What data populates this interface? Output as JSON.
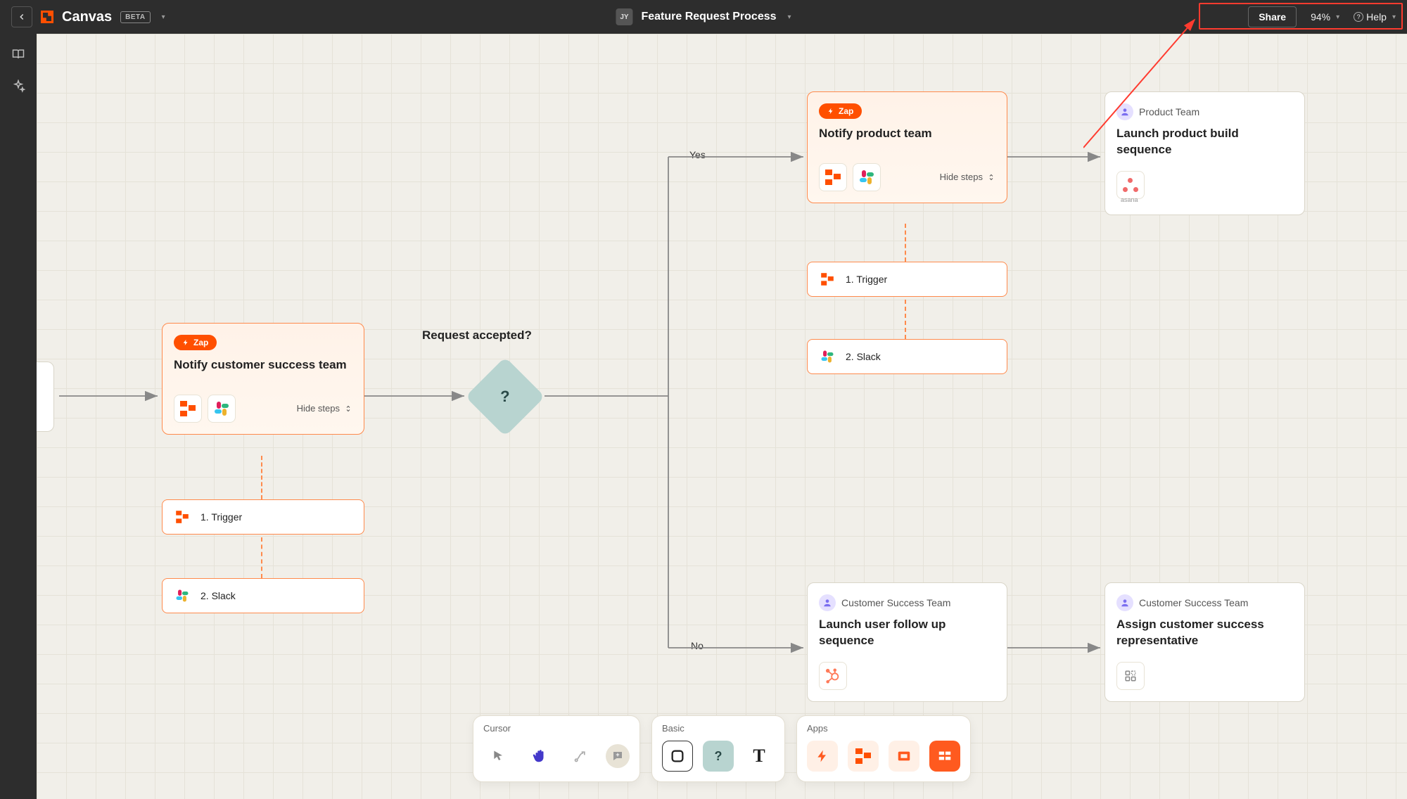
{
  "header": {
    "app_name": "Canvas",
    "beta_label": "BETA",
    "user_initials": "JY",
    "doc_title": "Feature Request Process",
    "share_label": "Share",
    "zoom_label": "94%",
    "help_label": "Help"
  },
  "decision": {
    "title": "Request accepted?",
    "symbol": "?",
    "yes_label": "Yes",
    "no_label": "No"
  },
  "zap1": {
    "badge": "Zap",
    "title": "Notify customer success team",
    "hide_label": "Hide steps",
    "step1": "1. Trigger",
    "step2": "2. Slack"
  },
  "zap2": {
    "badge": "Zap",
    "title": "Notify product team",
    "hide_label": "Hide steps",
    "step1": "1. Trigger",
    "step2": "2. Slack"
  },
  "card_product": {
    "team": "Product Team",
    "title": "Launch product build sequence"
  },
  "card_followup": {
    "team": "Customer Success Team",
    "title": "Launch user follow up sequence"
  },
  "card_assign": {
    "team": "Customer Success Team",
    "title": "Assign customer success representative"
  },
  "toolbar": {
    "group_cursor": "Cursor",
    "group_basic": "Basic",
    "group_apps": "Apps"
  },
  "icons": {
    "zapier": "zapier-icon",
    "slack": "slack-icon",
    "asana": "asana-icon",
    "hubspot": "hubspot-icon",
    "widget": "widget-icon"
  },
  "colors": {
    "accent_orange": "#ff4f00",
    "node_border": "#ff8a4c",
    "diamond_teal": "#b8d4d0",
    "canvas_bg": "#f1efe9"
  }
}
